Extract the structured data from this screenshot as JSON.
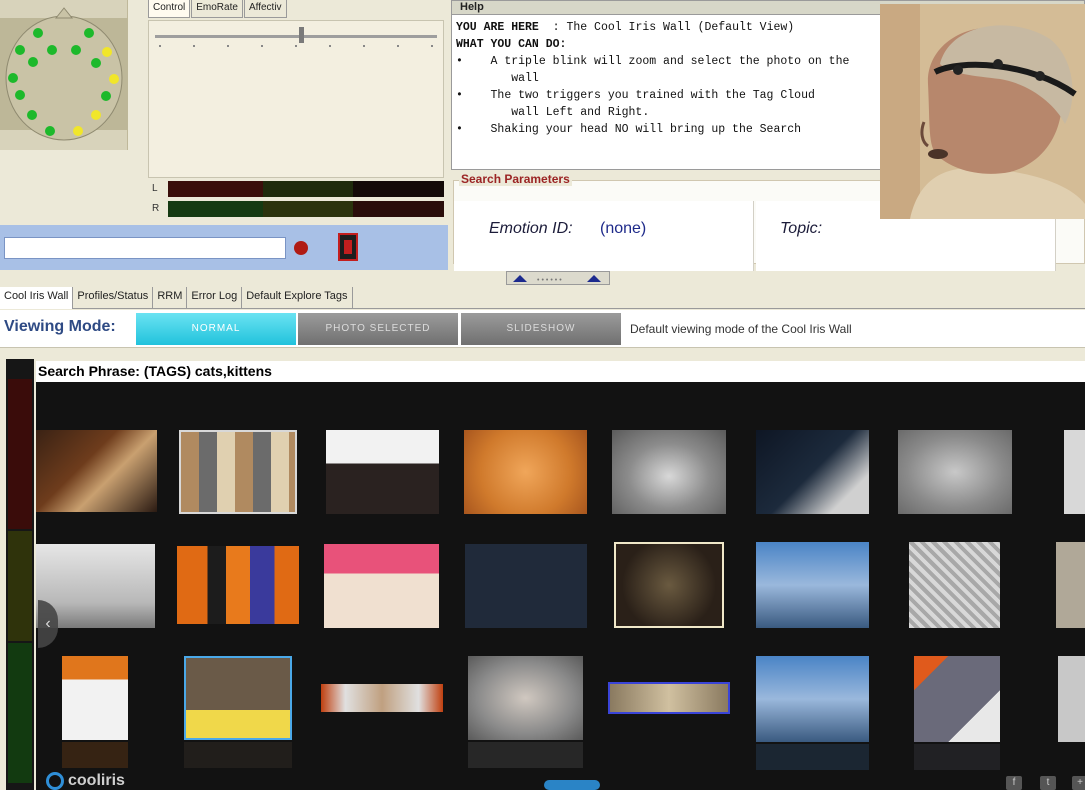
{
  "signal_panel": {
    "tabs": [
      "Control",
      "EmoRate",
      "Affectiv"
    ],
    "left_label": "L",
    "right_label": "R"
  },
  "help": {
    "title": "Help",
    "you_are_here_label": "YOU ARE HERE",
    "you_are_here_value": ": The Cool Iris Wall (Default View)",
    "what_you_can_do": "WHAT YOU CAN DO:",
    "bullets": [
      "A triple blink will zoom and select the photo on the\n        wall",
      "The two triggers you trained with the Tag Cloud\n        wall Left and Right.",
      "Shaking your head NO will bring up the Search"
    ]
  },
  "search_params": {
    "legend": "Search Parameters",
    "emotion_label": "Emotion ID:",
    "emotion_value": "(none)",
    "topic_label": "Topic:"
  },
  "main_tabs": [
    "Cool Iris Wall",
    "Profiles/Status",
    "RRM",
    "Error Log",
    "Default Explore Tags"
  ],
  "viewing": {
    "label": "Viewing Mode:",
    "modes": [
      "NORMAL",
      "PHOTO SELECTED",
      "SLIDESHOW"
    ],
    "description": "Default viewing mode of the Cool Iris Wall"
  },
  "wall": {
    "search_phrase": "Search Phrase: (TAGS) cats,kittens",
    "brand": "cooliris"
  },
  "colors": {
    "accent_cyan": "#21c2dc",
    "title_blue": "#2e4a84",
    "legend_red": "#9b2424"
  },
  "icons": [
    "record-icon",
    "device-icon",
    "chevron-left-icon",
    "facebook-icon",
    "twitter-icon",
    "share-icon"
  ]
}
